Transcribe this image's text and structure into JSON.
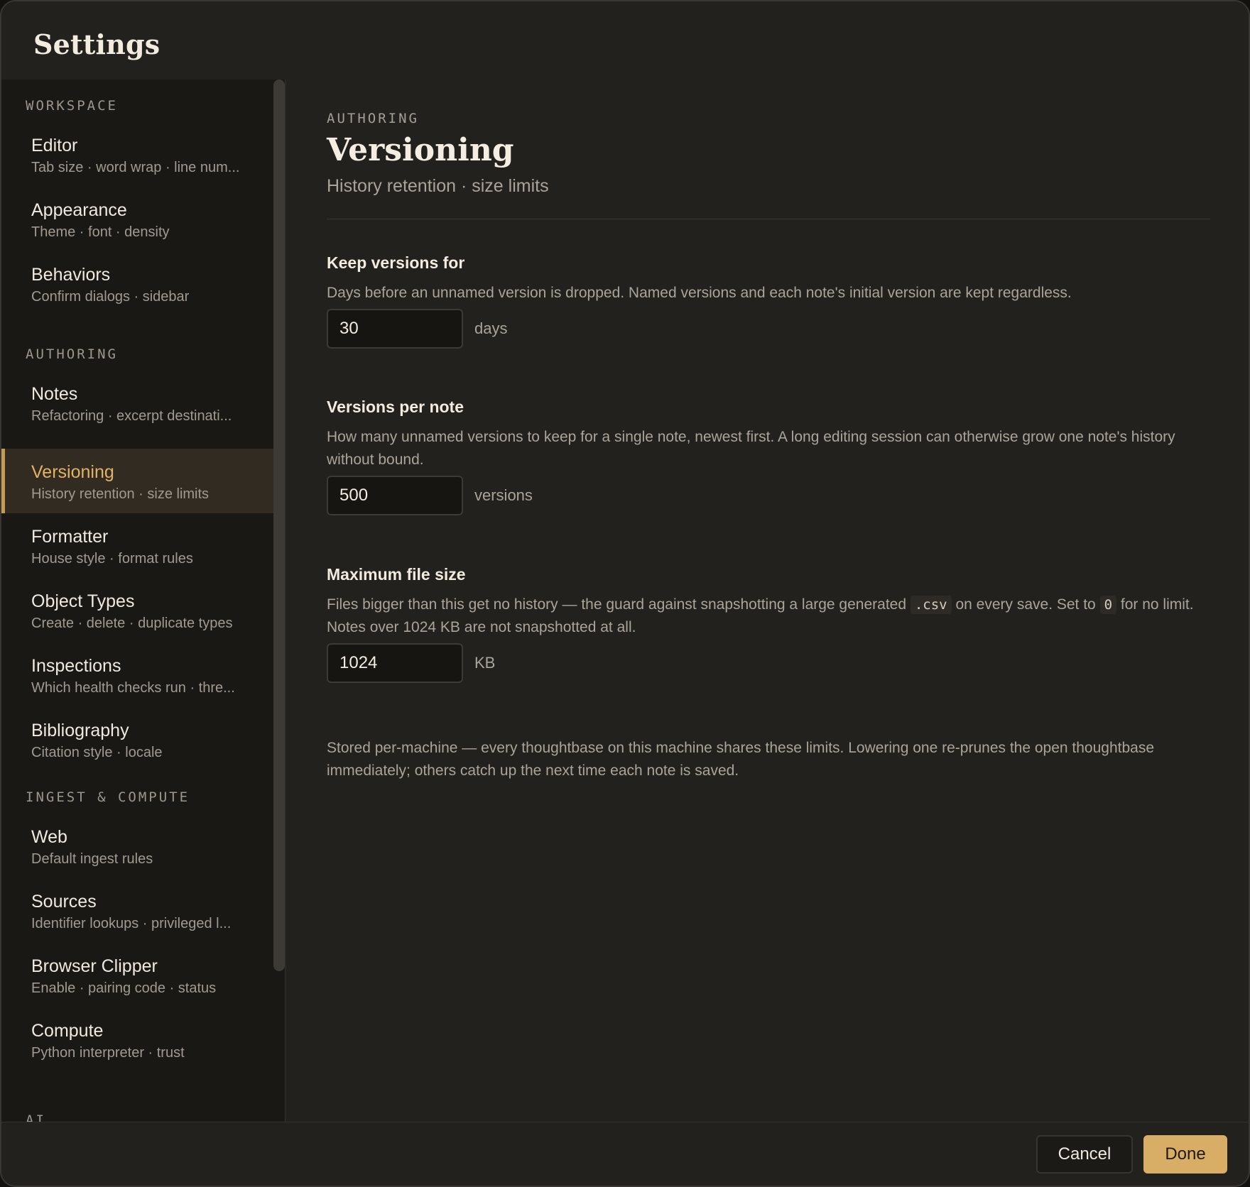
{
  "window": {
    "title": "Settings"
  },
  "sidebar": {
    "sections": [
      {
        "label": "WORKSPACE",
        "items": [
          {
            "title": "Editor",
            "subtitle": "Tab size · word wrap · line num..."
          },
          {
            "title": "Appearance",
            "subtitle": "Theme · font · density"
          },
          {
            "title": "Behaviors",
            "subtitle": "Confirm dialogs · sidebar"
          }
        ]
      },
      {
        "label": "AUTHORING",
        "items": [
          {
            "title": "Notes",
            "subtitle": "Refactoring · excerpt destinati..."
          },
          {
            "title": "Versioning",
            "subtitle": "History retention · size limits",
            "active": true
          },
          {
            "title": "Formatter",
            "subtitle": "House style · format rules"
          },
          {
            "title": "Object Types",
            "subtitle": "Create · delete · duplicate types"
          },
          {
            "title": "Inspections",
            "subtitle": "Which health checks run · thre..."
          },
          {
            "title": "Bibliography",
            "subtitle": "Citation style · locale"
          }
        ]
      },
      {
        "label": "INGEST & COMPUTE",
        "items": [
          {
            "title": "Web",
            "subtitle": "Default ingest rules"
          },
          {
            "title": "Sources",
            "subtitle": "Identifier lookups · privileged l..."
          },
          {
            "title": "Browser Clipper",
            "subtitle": "Enable · pairing code · status"
          },
          {
            "title": "Compute",
            "subtitle": "Python interpreter · trust"
          }
        ]
      },
      {
        "label": "AI",
        "items": []
      }
    ]
  },
  "main": {
    "eyebrow": "AUTHORING",
    "title": "Versioning",
    "subtitle": "History retention · size limits",
    "keep_versions": {
      "label": "Keep versions for",
      "description": "Days before an unnamed version is dropped. Named versions and each note's initial version are kept regardless.",
      "value": "30",
      "unit": "days"
    },
    "versions_per_note": {
      "label": "Versions per note",
      "description": "How many unnamed versions to keep for a single note, newest first. A long editing session can otherwise grow one note's history without bound.",
      "value": "500",
      "unit": "versions"
    },
    "max_file_size": {
      "label": "Maximum file size",
      "desc_part1": "Files bigger than this get no history — the guard against snapshotting a large generated ",
      "code1": ".csv",
      "desc_part2": " on every save. Set to ",
      "code2": "0",
      "desc_part3": " for no limit. Notes over 1024 KB are not snapshotted at all.",
      "value": "1024",
      "unit": "KB"
    },
    "footnote": "Stored per-machine — every thoughtbase on this machine shares these limits. Lowering one re-prunes the open thoughtbase immediately; others catch up the next time each note is saved."
  },
  "footer": {
    "cancel_label": "Cancel",
    "done_label": "Done"
  },
  "colors": {
    "accent": "#d8ae66",
    "active_text": "#e2b265",
    "background": "#23211d",
    "sidebar_bg": "#1a1815"
  }
}
